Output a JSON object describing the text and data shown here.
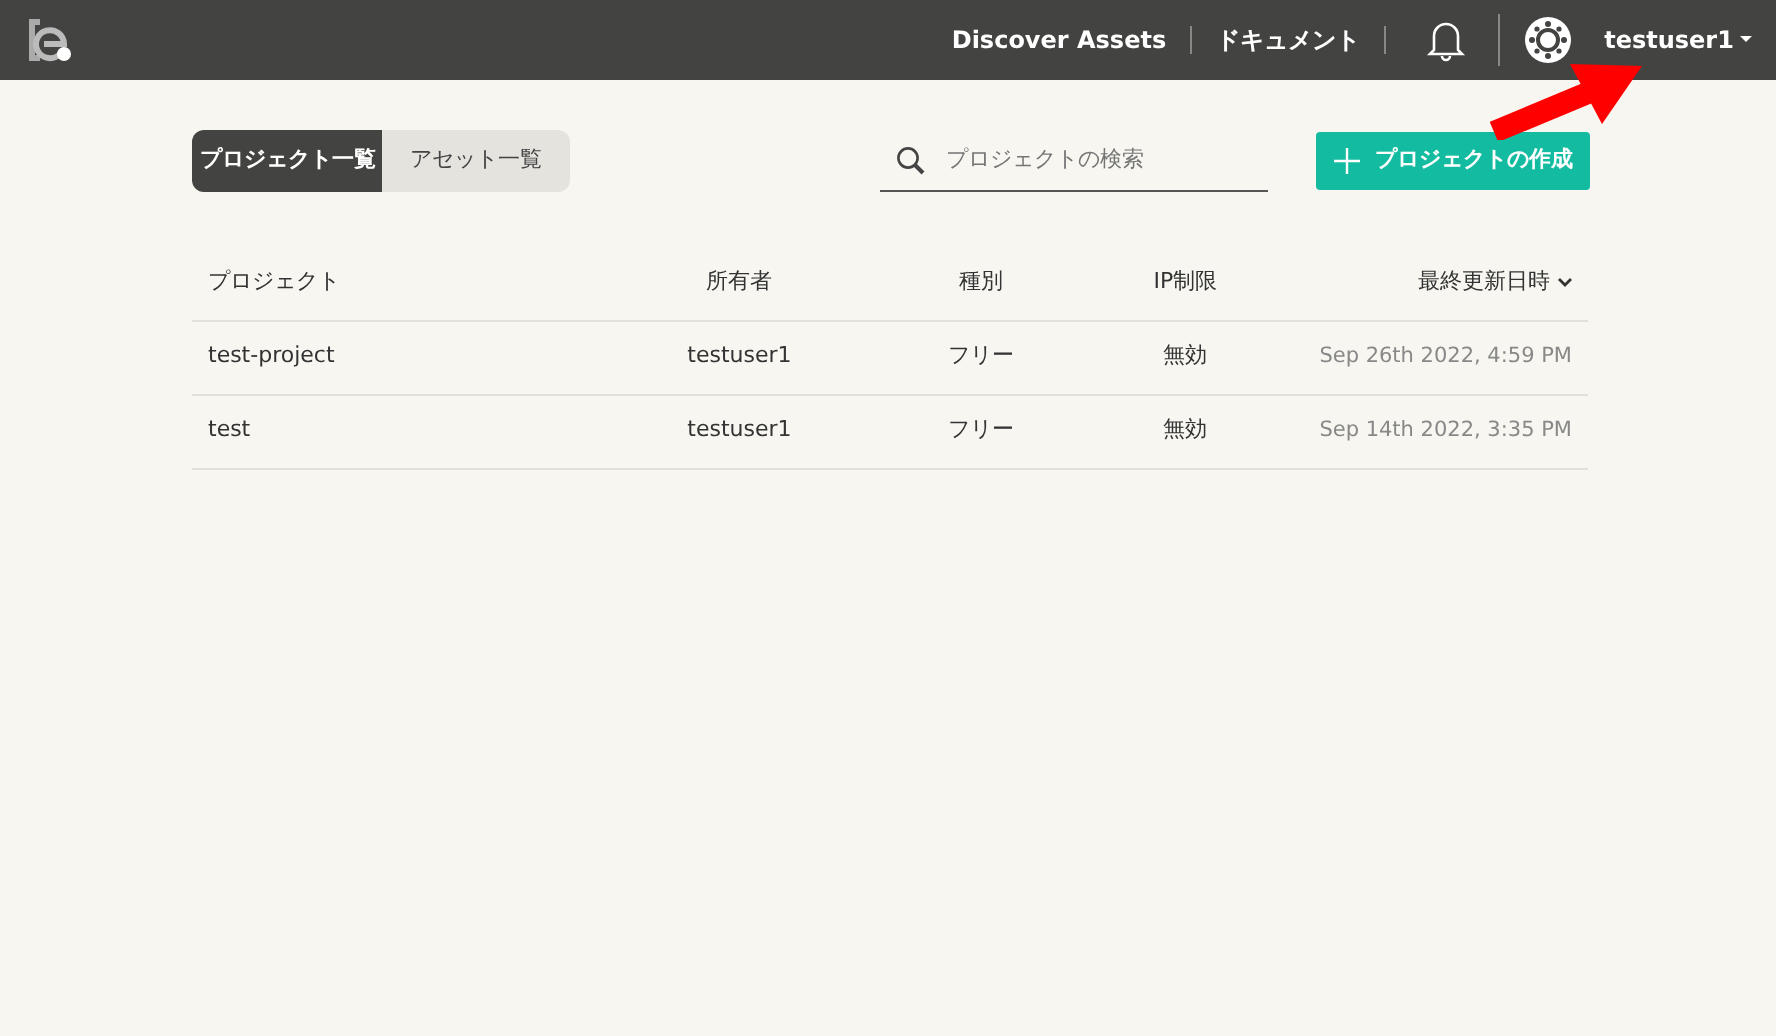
{
  "navbar": {
    "links": [
      "Discover Assets",
      "ドキュメント"
    ],
    "user": "testuser1"
  },
  "tabs": [
    {
      "label": "プロジェクト一覧",
      "selected": true
    },
    {
      "label": "アセット一覧",
      "selected": false
    }
  ],
  "search": {
    "placeholder": "プロジェクトの検索"
  },
  "create_button": "プロジェクトの作成",
  "table": {
    "columns": [
      {
        "label": "プロジェクト",
        "sorted": false
      },
      {
        "label": "所有者",
        "sorted": false
      },
      {
        "label": "種別",
        "sorted": false
      },
      {
        "label": "IP制限",
        "sorted": false
      },
      {
        "label": "最終更新日時",
        "sorted": true
      }
    ],
    "rows": [
      [
        "test-project",
        "testuser1",
        "フリー",
        "無効",
        "Sep 26th 2022, 4:59 PM"
      ],
      [
        "test",
        "testuser1",
        "フリー",
        "無効",
        "Sep 14th 2022, 3:35 PM"
      ]
    ]
  },
  "annotation": {
    "kind": "arrow"
  }
}
